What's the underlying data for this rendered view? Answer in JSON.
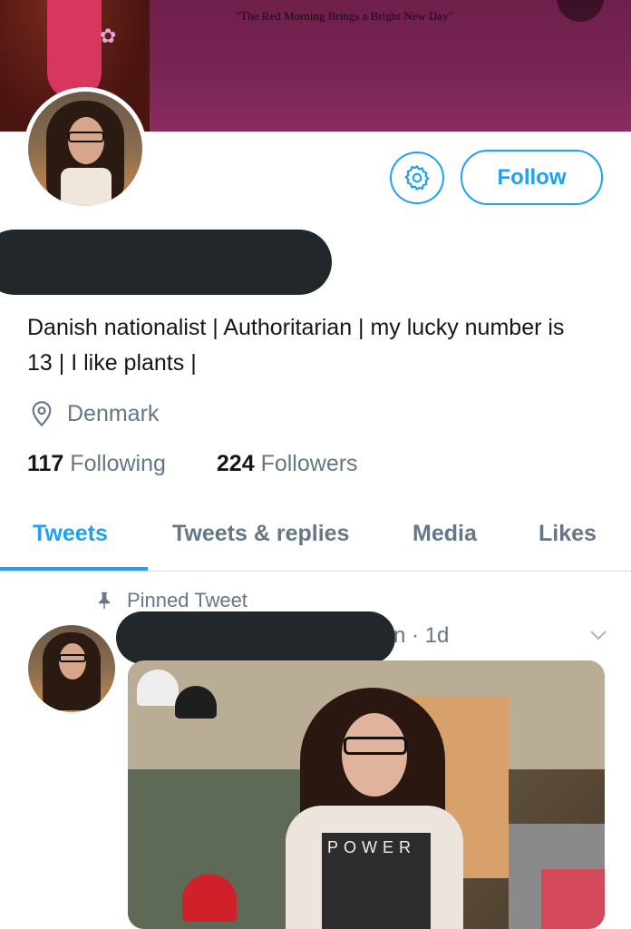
{
  "banner": {
    "quote": "\"The Red Morning Brings a Bright New Day\""
  },
  "profile": {
    "follow_label": "Follow",
    "bio": "Danish nationalist | Authoritarian | my lucky number is 13 | I like plants |",
    "location": "Denmark",
    "following_count": "117",
    "following_label": "Following",
    "followers_count": "224",
    "followers_label": "Followers"
  },
  "tabs": [
    {
      "label": "Tweets",
      "active": true
    },
    {
      "label": "Tweets & replies",
      "active": false
    },
    {
      "label": "Media",
      "active": false
    },
    {
      "label": "Likes",
      "active": false
    }
  ],
  "tweet": {
    "pinned_label": "Pinned Tweet",
    "time": "n · 1d",
    "photo_shirt_text": "POWER"
  },
  "colors": {
    "accent": "#1da1f2",
    "secondary_text": "#657786",
    "banner": "#7a2655"
  },
  "icons": {
    "settings": "gear-icon",
    "location": "location-pin-icon",
    "pinned": "pushpin-icon",
    "more": "chevron-down-icon"
  }
}
